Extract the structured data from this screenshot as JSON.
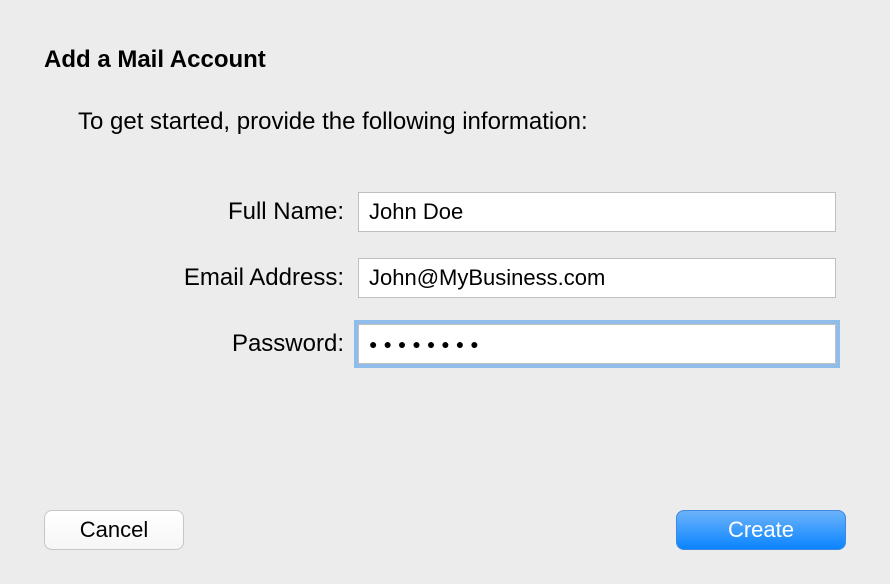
{
  "dialog": {
    "title": "Add a Mail Account",
    "instruction": "To get started, provide the following information:",
    "fields": {
      "fullName": {
        "label": "Full Name:",
        "value": "John Doe"
      },
      "email": {
        "label": "Email Address:",
        "value": "John@MyBusiness.com"
      },
      "password": {
        "label": "Password:",
        "value": "●●●●●●●●"
      }
    },
    "buttons": {
      "cancel": "Cancel",
      "create": "Create"
    }
  }
}
